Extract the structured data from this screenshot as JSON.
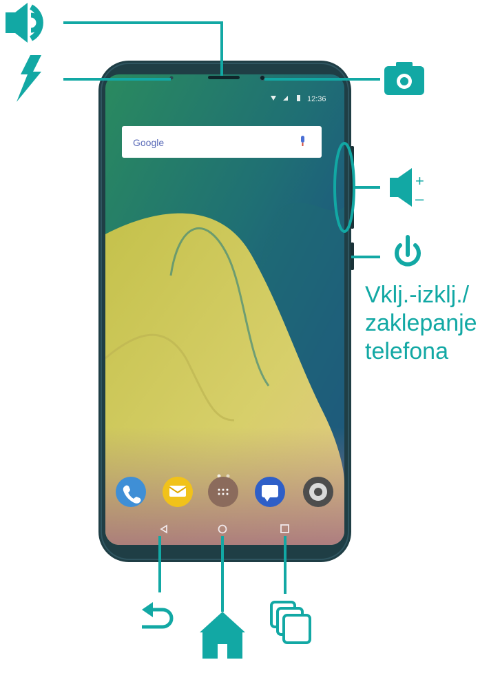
{
  "colors": {
    "accent": "#12a8a4",
    "phone_body": "#1f3e45",
    "screen_green": "#23776a",
    "screen_blue": "#1c5a93",
    "wallpaper_yellow": "#cfc85a"
  },
  "phone": {
    "status_bar": {
      "time": "12:36",
      "icons": [
        "wifi-icon",
        "signal-icon",
        "battery-icon"
      ]
    },
    "search_bar": {
      "brand": "Google",
      "icon": "microphone-icon"
    },
    "page_indicator_dots": 2,
    "dock_apps": [
      "phone-icon",
      "messages-icon",
      "app-drawer-icon",
      "sms-icon",
      "camera-app-icon"
    ],
    "nav_bar": [
      "back-icon",
      "home-icon",
      "recents-icon"
    ]
  },
  "callouts": {
    "earpiece": {
      "icon": "speaker-icon"
    },
    "flash": {
      "icon": "flash-icon"
    },
    "front_camera": {
      "icon": "camera-icon"
    },
    "volume": {
      "icon": "volume-icon",
      "plus": "+",
      "minus": "–"
    },
    "power": {
      "icon": "power-icon",
      "label_lines": [
        "Vklj.-izklj./",
        "zaklepanje",
        "telefona"
      ]
    },
    "back": {
      "icon": "back-arrow-icon"
    },
    "home": {
      "icon": "home-icon"
    },
    "recents": {
      "icon": "recent-apps-icon"
    }
  }
}
